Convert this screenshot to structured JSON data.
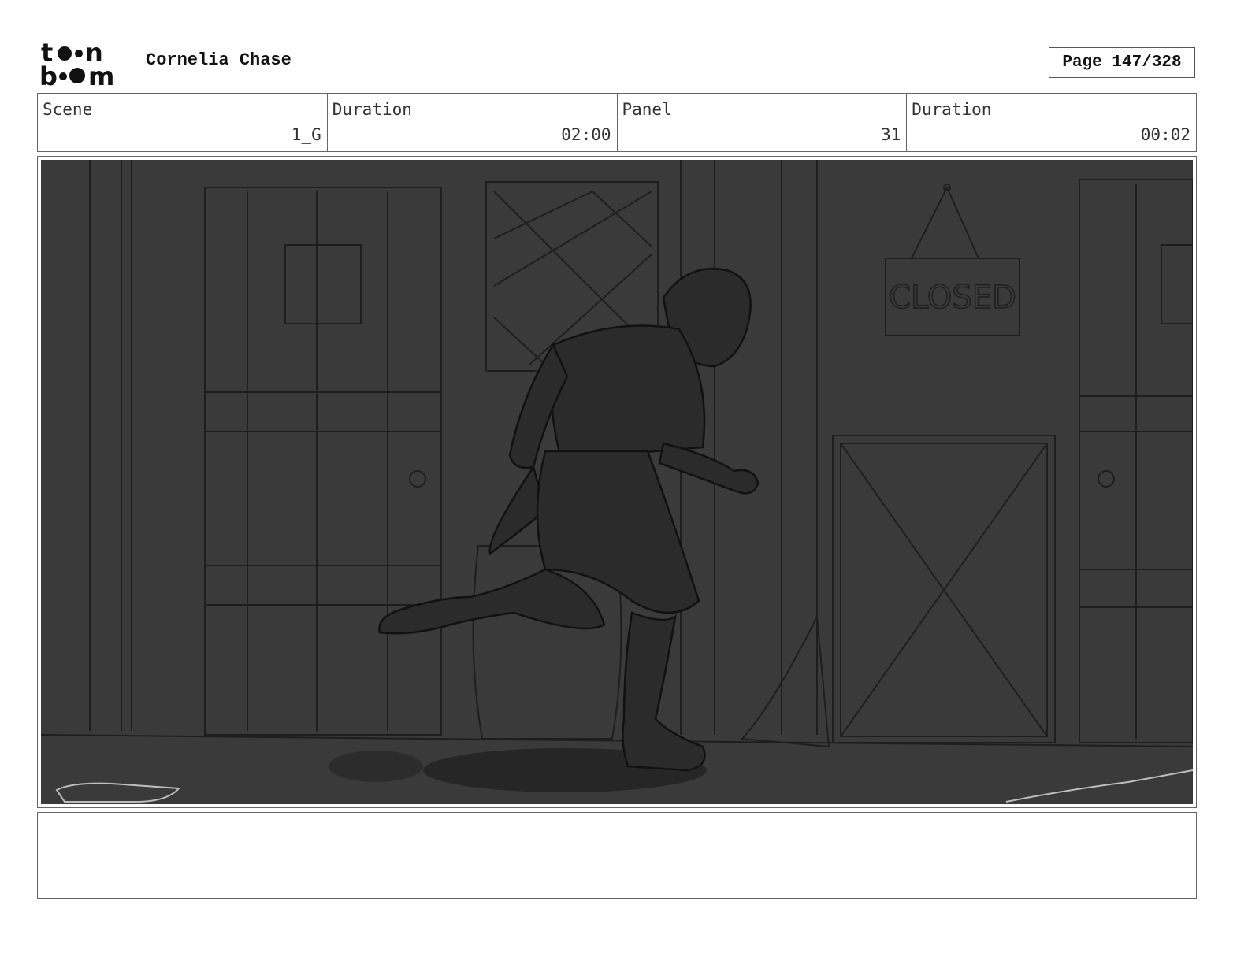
{
  "header": {
    "logo_text_top": "toon",
    "logo_text_bottom": "boom",
    "project_title": "Cornelia Chase",
    "page_label": "Page 147/328"
  },
  "info": {
    "scene_label": "Scene",
    "scene_value": "1_G",
    "scene_duration_label": "Duration",
    "scene_duration_value": "02:00",
    "panel_label": "Panel",
    "panel_value": "31",
    "panel_duration_label": "Duration",
    "panel_duration_value": "00:02"
  },
  "panel": {
    "sign_text": "CLOSED",
    "background_color": "#3a3a3a",
    "line_color": "#1e1e1e",
    "character_fill": "#2b2b2b"
  },
  "notes": {
    "text": ""
  }
}
